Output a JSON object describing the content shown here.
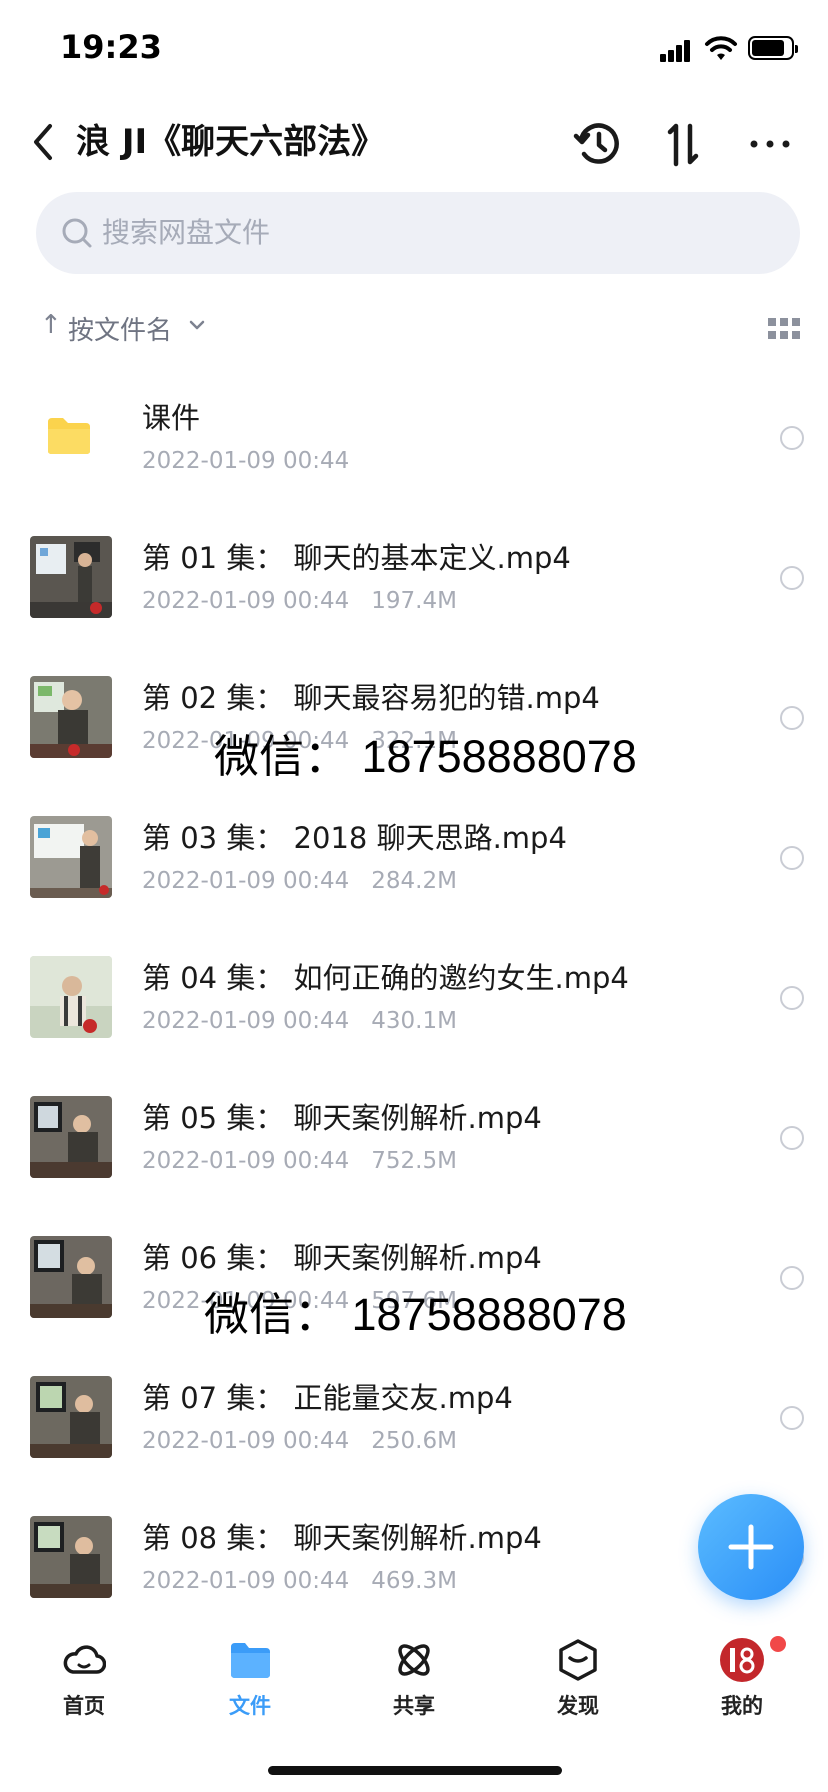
{
  "status_bar": {
    "time": "19:23"
  },
  "header": {
    "title": "浪 JI《聊天六部法》"
  },
  "search": {
    "placeholder": "搜索网盘文件"
  },
  "sort": {
    "arrow": "↑",
    "label": "按文件名"
  },
  "files": [
    {
      "name": "课件",
      "date": "2022-01-09 00:44",
      "size": "",
      "type": "folder"
    },
    {
      "name": "第 01 集：  聊天的基本定义.mp4",
      "date": "2022-01-09 00:44",
      "size": "197.4M",
      "type": "video"
    },
    {
      "name": "第 02 集：  聊天最容易犯的错.mp4",
      "date": "2022-01-09 00:44",
      "size": "322.1M",
      "type": "video"
    },
    {
      "name": "第 03 集：  2018 聊天思路.mp4",
      "date": "2022-01-09 00:44",
      "size": "284.2M",
      "type": "video"
    },
    {
      "name": "第 04 集：  如何正确的邀约女生.mp4",
      "date": "2022-01-09 00:44",
      "size": "430.1M",
      "type": "video"
    },
    {
      "name": "第 05 集：  聊天案例解析.mp4",
      "date": "2022-01-09 00:44",
      "size": "752.5M",
      "type": "video"
    },
    {
      "name": "第 06 集：  聊天案例解析.mp4",
      "date": "2022-01-09 00:44",
      "size": "597.6M",
      "type": "video"
    },
    {
      "name": "第 07 集：  正能量交友.mp4",
      "date": "2022-01-09 00:44",
      "size": "250.6M",
      "type": "video"
    },
    {
      "name": "第 08 集：  聊天案例解析.mp4",
      "date": "2022-01-09 00:44",
      "size": "469.3M",
      "type": "video"
    }
  ],
  "watermark": {
    "text": "微信：  18758888078"
  },
  "tabs": [
    {
      "label": "首页",
      "icon": "cloud-icon"
    },
    {
      "label": "文件",
      "icon": "folder-icon"
    },
    {
      "label": "共享",
      "icon": "share-orbit-icon"
    },
    {
      "label": "发现",
      "icon": "discover-box-icon"
    },
    {
      "label": "我的",
      "icon": "avatar"
    }
  ],
  "colors": {
    "accent": "#3b9cf8",
    "folder": "#fbd34d",
    "badge": "#f14848"
  }
}
